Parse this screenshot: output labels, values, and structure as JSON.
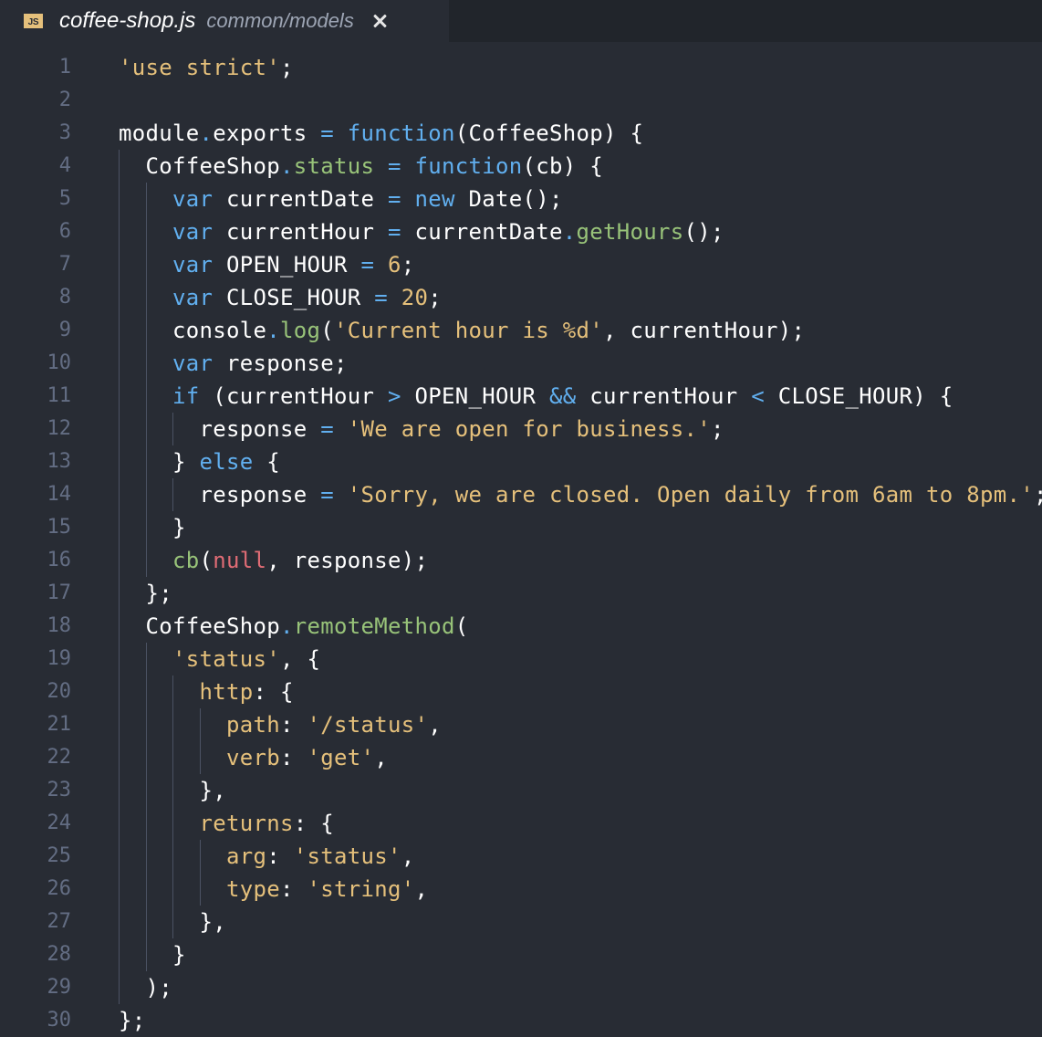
{
  "tab": {
    "icon_label": "JS",
    "filename": "coffee-shop.js",
    "path": "common/models"
  },
  "colors": {
    "background": "#282c34",
    "tabbar": "#21252b",
    "line_number": "#636d83",
    "text": "#ffffff",
    "string": "#e5c07b",
    "keyword": "#61afef",
    "call": "#98c379",
    "null": "#e06c75"
  },
  "lines": [
    {
      "n": "1",
      "indent": 0,
      "t": [
        [
          "'use strict'",
          "str"
        ],
        [
          ";",
          ""
        ]
      ]
    },
    {
      "n": "2",
      "indent": 0,
      "t": []
    },
    {
      "n": "3",
      "indent": 0,
      "t": [
        [
          "module",
          ""
        ],
        [
          ".",
          "dot"
        ],
        [
          "exports ",
          ""
        ],
        [
          "=",
          "op"
        ],
        [
          " ",
          ""
        ],
        [
          "function",
          "kw"
        ],
        [
          "(CoffeeShop) {",
          ""
        ]
      ]
    },
    {
      "n": "4",
      "indent": 1,
      "t": [
        [
          "CoffeeShop",
          ""
        ],
        [
          ".",
          "dot"
        ],
        [
          "status",
          "call"
        ],
        [
          " ",
          ""
        ],
        [
          "=",
          "op"
        ],
        [
          " ",
          ""
        ],
        [
          "function",
          "kw"
        ],
        [
          "(cb) {",
          ""
        ]
      ]
    },
    {
      "n": "5",
      "indent": 2,
      "t": [
        [
          "var",
          "kw"
        ],
        [
          " currentDate ",
          ""
        ],
        [
          "=",
          "op"
        ],
        [
          " ",
          ""
        ],
        [
          "new",
          "kw"
        ],
        [
          " Date();",
          ""
        ]
      ]
    },
    {
      "n": "6",
      "indent": 2,
      "t": [
        [
          "var",
          "kw"
        ],
        [
          " currentHour ",
          ""
        ],
        [
          "=",
          "op"
        ],
        [
          " currentDate",
          ""
        ],
        [
          ".",
          "dot"
        ],
        [
          "getHours",
          "call"
        ],
        [
          "();",
          ""
        ]
      ]
    },
    {
      "n": "7",
      "indent": 2,
      "t": [
        [
          "var",
          "kw"
        ],
        [
          " OPEN_HOUR ",
          ""
        ],
        [
          "=",
          "op"
        ],
        [
          " ",
          ""
        ],
        [
          "6",
          "num"
        ],
        [
          ";",
          ""
        ]
      ]
    },
    {
      "n": "8",
      "indent": 2,
      "t": [
        [
          "var",
          "kw"
        ],
        [
          " CLOSE_HOUR ",
          ""
        ],
        [
          "=",
          "op"
        ],
        [
          " ",
          ""
        ],
        [
          "20",
          "num"
        ],
        [
          ";",
          ""
        ]
      ]
    },
    {
      "n": "9",
      "indent": 2,
      "t": [
        [
          "console",
          ""
        ],
        [
          ".",
          "dot"
        ],
        [
          "log",
          "call"
        ],
        [
          "(",
          ""
        ],
        [
          "'Current hour is %d'",
          "str"
        ],
        [
          ", currentHour);",
          ""
        ]
      ]
    },
    {
      "n": "10",
      "indent": 2,
      "t": [
        [
          "var",
          "kw"
        ],
        [
          " response;",
          ""
        ]
      ]
    },
    {
      "n": "11",
      "indent": 2,
      "t": [
        [
          "if",
          "kw"
        ],
        [
          " (currentHour ",
          ""
        ],
        [
          ">",
          "op"
        ],
        [
          " OPEN_HOUR ",
          ""
        ],
        [
          "&&",
          "op"
        ],
        [
          " currentHour ",
          ""
        ],
        [
          "<",
          "op"
        ],
        [
          " CLOSE_HOUR) {",
          ""
        ]
      ]
    },
    {
      "n": "12",
      "indent": 3,
      "t": [
        [
          "response ",
          ""
        ],
        [
          "=",
          "op"
        ],
        [
          " ",
          ""
        ],
        [
          "'We are open for business.'",
          "str"
        ],
        [
          ";",
          ""
        ]
      ]
    },
    {
      "n": "13",
      "indent": 2,
      "t": [
        [
          "} ",
          ""
        ],
        [
          "else",
          "kw"
        ],
        [
          " {",
          ""
        ]
      ]
    },
    {
      "n": "14",
      "indent": 3,
      "t": [
        [
          "response ",
          ""
        ],
        [
          "=",
          "op"
        ],
        [
          " ",
          ""
        ],
        [
          "'Sorry, we are closed. Open daily from 6am to 8pm.'",
          "str"
        ],
        [
          ";",
          ""
        ]
      ]
    },
    {
      "n": "15",
      "indent": 2,
      "t": [
        [
          "}",
          ""
        ]
      ]
    },
    {
      "n": "16",
      "indent": 2,
      "t": [
        [
          "cb",
          "call"
        ],
        [
          "(",
          ""
        ],
        [
          "null",
          "null"
        ],
        [
          ", response);",
          ""
        ]
      ]
    },
    {
      "n": "17",
      "indent": 1,
      "t": [
        [
          "};",
          ""
        ]
      ]
    },
    {
      "n": "18",
      "indent": 1,
      "t": [
        [
          "CoffeeShop",
          ""
        ],
        [
          ".",
          "dot"
        ],
        [
          "remoteMethod",
          "call"
        ],
        [
          "(",
          ""
        ]
      ]
    },
    {
      "n": "19",
      "indent": 2,
      "t": [
        [
          "'status'",
          "str"
        ],
        [
          ", {",
          ""
        ]
      ]
    },
    {
      "n": "20",
      "indent": 3,
      "t": [
        [
          "http",
          "prop"
        ],
        [
          ": {",
          ""
        ]
      ]
    },
    {
      "n": "21",
      "indent": 4,
      "t": [
        [
          "path",
          "prop"
        ],
        [
          ": ",
          ""
        ],
        [
          "'/status'",
          "str"
        ],
        [
          ",",
          ""
        ]
      ]
    },
    {
      "n": "22",
      "indent": 4,
      "t": [
        [
          "verb",
          "prop"
        ],
        [
          ": ",
          ""
        ],
        [
          "'get'",
          "str"
        ],
        [
          ",",
          ""
        ]
      ]
    },
    {
      "n": "23",
      "indent": 3,
      "t": [
        [
          "},",
          ""
        ]
      ]
    },
    {
      "n": "24",
      "indent": 3,
      "t": [
        [
          "returns",
          "prop"
        ],
        [
          ": {",
          ""
        ]
      ]
    },
    {
      "n": "25",
      "indent": 4,
      "t": [
        [
          "arg",
          "prop"
        ],
        [
          ": ",
          ""
        ],
        [
          "'status'",
          "str"
        ],
        [
          ",",
          ""
        ]
      ]
    },
    {
      "n": "26",
      "indent": 4,
      "t": [
        [
          "type",
          "prop"
        ],
        [
          ": ",
          ""
        ],
        [
          "'string'",
          "str"
        ],
        [
          ",",
          ""
        ]
      ]
    },
    {
      "n": "27",
      "indent": 3,
      "t": [
        [
          "},",
          ""
        ]
      ]
    },
    {
      "n": "28",
      "indent": 2,
      "t": [
        [
          "}",
          ""
        ]
      ]
    },
    {
      "n": "29",
      "indent": 1,
      "t": [
        [
          ");",
          ""
        ]
      ]
    },
    {
      "n": "30",
      "indent": 0,
      "t": [
        [
          "};",
          ""
        ]
      ]
    }
  ]
}
